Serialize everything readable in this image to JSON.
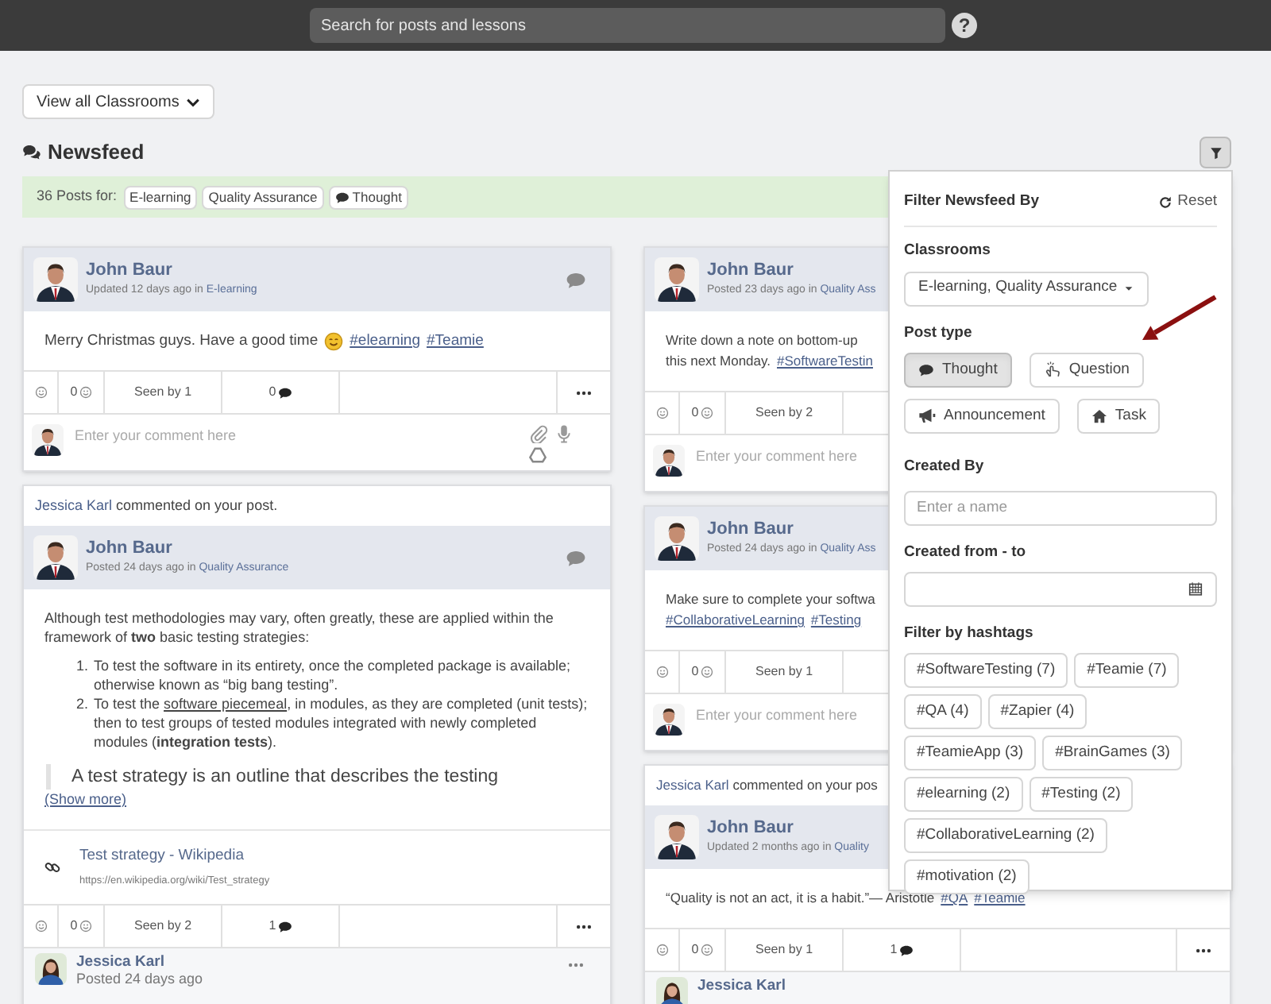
{
  "topbar": {
    "search_placeholder": "Search for posts and lessons",
    "help": "?"
  },
  "classroom_button": "View all Classrooms",
  "heading": "Newsfeed",
  "summary": {
    "label": "36 Posts for:",
    "chips": [
      {
        "kind": "plain",
        "text": "E-learning"
      },
      {
        "kind": "plain",
        "text": "Quality Assurance"
      },
      {
        "kind": "thought",
        "text": "Thought"
      }
    ]
  },
  "columns": [
    [
      {
        "author": "John Baur",
        "meta": "Updated 12 days ago in",
        "classroom": "E-learning",
        "body": [
          {
            "kind": "line",
            "parts": [
              {
                "kind": "text",
                "text": "Merry Christmas guys. Have a good time"
              },
              {
                "kind": "emoji"
              },
              {
                "kind": "tag",
                "text": "#elearning"
              },
              {
                "kind": "tag",
                "text": "#Teamie"
              }
            ]
          }
        ],
        "stats": {
          "reactions": "0",
          "seen": "Seen by 1",
          "comments": "0"
        },
        "comment_box": {
          "placeholder": "Enter your comment here"
        }
      },
      {
        "notice": {
          "actor": "Jessica Karl",
          "text": "commented on your post."
        },
        "author": "John Baur",
        "meta": "Posted 24 days ago in",
        "classroom": "Quality Assurance",
        "body": [
          {
            "kind": "paragraph",
            "text": "Although test methodologies may vary, often greatly, these are applied within the framework of **two** basic testing strategies:"
          },
          {
            "kind": "list",
            "items": [
              {
                "number": "1.",
                "parts": [
                  {
                    "kind": "text",
                    "text": "To test the software in its entirety, once the completed package is available; otherwise known as “big bang testing”."
                  }
                ]
              },
              {
                "number": "2.",
                "parts": [
                  {
                    "kind": "text",
                    "text": "To test the "
                  },
                  {
                    "kind": "link",
                    "text": "software piecemeal"
                  },
                  {
                    "kind": "text",
                    "text": ", in modules, as they are completed (unit tests); then to test groups of tested modules integrated with newly completed modules (**integration tests**)."
                  }
                ]
              }
            ]
          },
          {
            "kind": "quote",
            "text": "A test strategy is an outline that describes the testing"
          },
          {
            "kind": "more",
            "text": "(Show more)"
          }
        ],
        "preview": {
          "title": "Test strategy - Wikipedia",
          "url": "https://en.wikipedia.org/wiki/Test_strategy"
        },
        "stats": {
          "reactions": "0",
          "seen": "Seen by 2",
          "comments": "1"
        },
        "reply": {
          "author": "Jessica Karl",
          "meta": "Posted 24 days ago"
        }
      }
    ],
    [
      {
        "author": "John Baur",
        "meta": "Posted 23 days ago in",
        "classroom": "Quality Ass",
        "body": [
          {
            "kind": "line",
            "parts": [
              {
                "kind": "text",
                "text": "Write down a note on bottom-up"
              }
            ]
          },
          {
            "kind": "line",
            "parts": [
              {
                "kind": "text",
                "text": "this next Monday."
              },
              {
                "kind": "tag",
                "text": "#SoftwareTestin"
              }
            ]
          }
        ],
        "stats": {
          "reactions": "0",
          "seen": "Seen by 2"
        },
        "comment_box": {
          "placeholder": "Enter your comment here"
        }
      },
      {
        "author": "John Baur",
        "meta": "Posted 24 days ago in",
        "classroom": "Quality Ass",
        "body": [
          {
            "kind": "line",
            "parts": [
              {
                "kind": "text",
                "text": "Make sure to complete your softwa"
              }
            ]
          },
          {
            "kind": "line",
            "parts": [
              {
                "kind": "tag",
                "text": "#CollaborativeLearning"
              },
              {
                "kind": "tag",
                "text": "#Testing"
              }
            ]
          }
        ],
        "stats": {
          "reactions": "0",
          "seen": "Seen by 1"
        },
        "comment_box": {
          "placeholder": "Enter your comment here"
        }
      },
      {
        "notice": {
          "actor": "Jessica Karl",
          "text": "commented on your pos"
        },
        "author": "John Baur",
        "meta": "Updated 2 months ago in",
        "classroom": "Quality",
        "body": [
          {
            "kind": "line",
            "parts": [
              {
                "kind": "text",
                "text": "“Quality is not an act, it is a habit.”— Aristotle"
              },
              {
                "kind": "tag",
                "text": "#QA"
              },
              {
                "kind": "tag",
                "text": "#Teamie"
              }
            ]
          }
        ],
        "stats": {
          "reactions": "0",
          "seen": "Seen by 1",
          "comments": "1"
        },
        "reply": {
          "author": "Jessica Karl"
        }
      }
    ]
  ],
  "filter": {
    "title": "Filter Newsfeed By",
    "reset": "Reset",
    "classrooms": {
      "label": "Classrooms",
      "value": "E-learning, Quality Assurance"
    },
    "post_type": {
      "label": "Post type",
      "options": [
        {
          "label": "Thought",
          "selected": true
        },
        {
          "label": "Question",
          "selected": false
        },
        {
          "label": "Announcement",
          "selected": false
        },
        {
          "label": "Task",
          "selected": false
        }
      ]
    },
    "created_by": {
      "label": "Created By",
      "placeholder": "Enter a name"
    },
    "created_range": {
      "label": "Created from - to"
    },
    "hashtags": {
      "label": "Filter by hashtags",
      "tags": [
        "#SoftwareTesting (7)",
        "#Teamie (7)",
        "#QA (4)",
        "#Zapier (4)",
        "#TeamieApp (3)",
        "#BrainGames (3)",
        "#elearning (2)",
        "#Testing (2)",
        "#CollaborativeLearning (2)",
        "#motivation (2)"
      ]
    }
  }
}
